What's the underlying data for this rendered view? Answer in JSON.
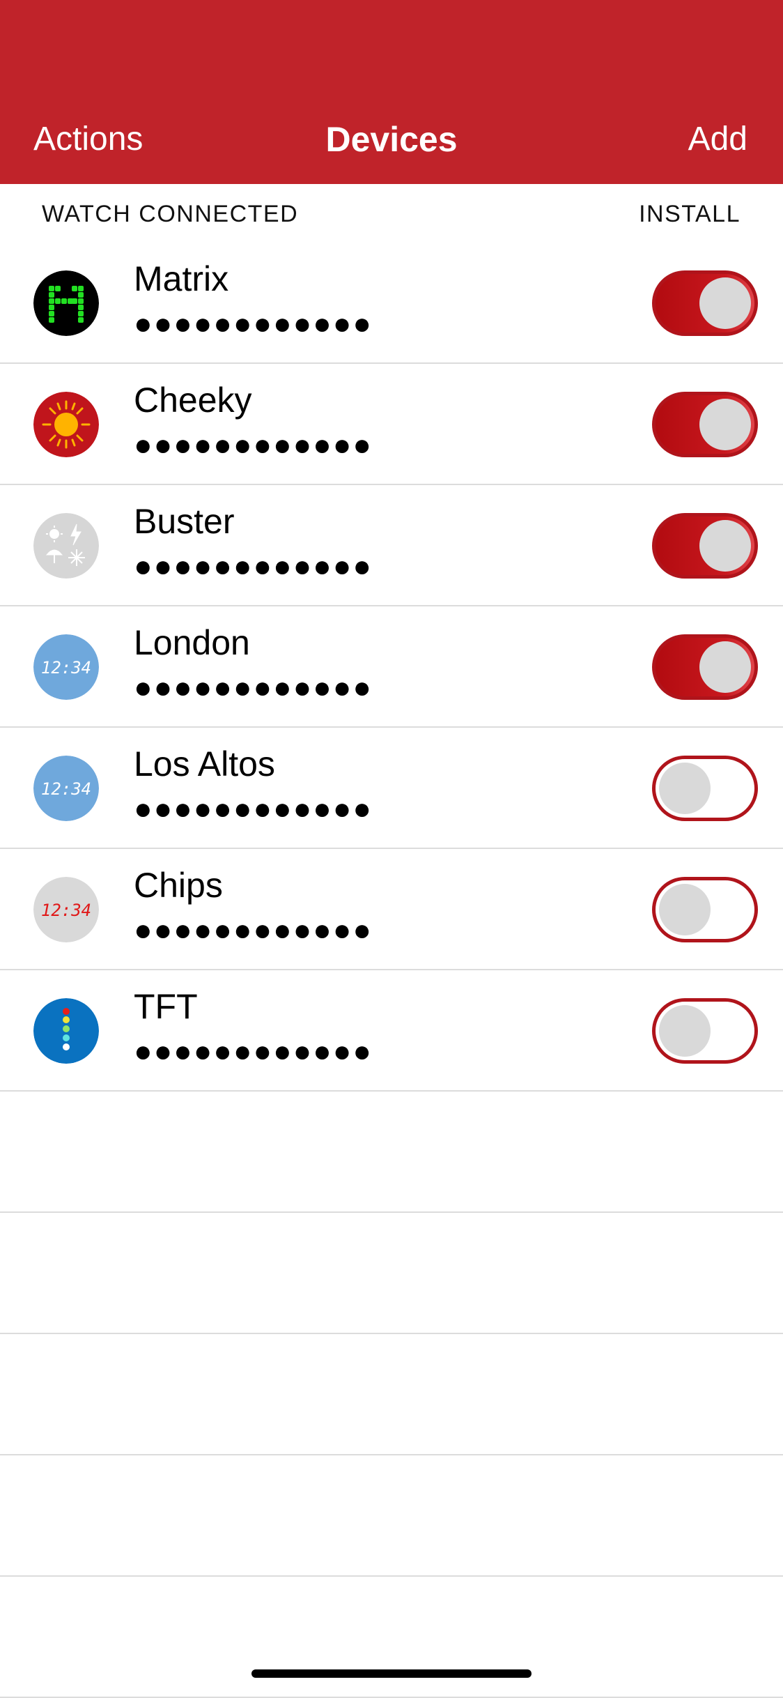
{
  "navbar": {
    "left_button": "Actions",
    "title": "Devices",
    "right_button": "Add",
    "background_color": "#c0232a"
  },
  "section": {
    "left_label": "WATCH CONNECTED",
    "right_label": "INSTALL"
  },
  "devices": [
    {
      "name": "Matrix",
      "subtitle": "●●●●●●●●●●●●",
      "icon": "matrix-icon",
      "installed": true
    },
    {
      "name": "Cheeky",
      "subtitle": "●●●●●●●●●●●●",
      "icon": "sun-icon",
      "installed": true
    },
    {
      "name": "Buster",
      "subtitle": "●●●●●●●●●●●●",
      "icon": "weather-icon",
      "installed": true
    },
    {
      "name": "London",
      "subtitle": "●●●●●●●●●●●●",
      "icon": "digital-clock-icon",
      "installed": true
    },
    {
      "name": "Los Altos",
      "subtitle": "●●●●●●●●●●●●",
      "icon": "digital-clock-icon",
      "installed": false
    },
    {
      "name": "Chips",
      "subtitle": "●●●●●●●●●●●●",
      "icon": "red-digital-clock-icon",
      "installed": false
    },
    {
      "name": "TFT",
      "subtitle": "●●●●●●●●●●●●",
      "icon": "traffic-light-icon",
      "installed": false
    }
  ],
  "colors": {
    "toggle_on": "#c0151c",
    "toggle_off_border": "#b0141b",
    "knob": "#d9d9d9"
  },
  "icon_texts": {
    "london_clock": "12:34",
    "los_altos_clock": "12:34",
    "chips_clock": "12:34"
  }
}
